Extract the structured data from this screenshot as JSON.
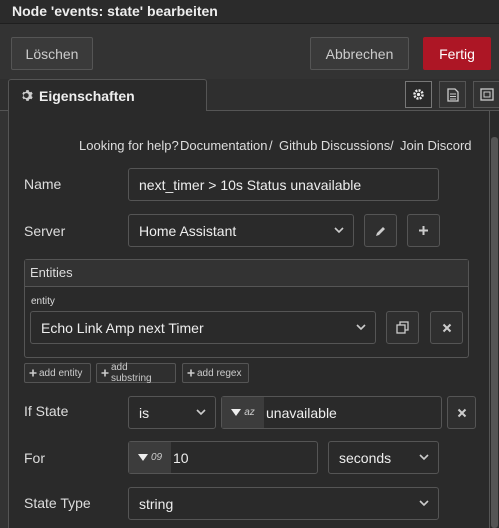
{
  "dialog": {
    "title": "Node 'events: state' bearbeiten"
  },
  "toolbar": {
    "delete_label": "Löschen",
    "cancel_label": "Abbrechen",
    "done_label": "Fertig"
  },
  "tabs": {
    "properties_label": "Eigenschaften"
  },
  "help": {
    "prefix": "Looking for help?",
    "links": [
      "Documentation",
      "Github Discussions",
      "Join Discord"
    ],
    "separator": "/"
  },
  "form": {
    "name": {
      "label": "Name",
      "value": "next_timer > 10s Status unavailable"
    },
    "server": {
      "label": "Server",
      "value": "Home Assistant"
    },
    "entities": {
      "header": "Entities",
      "sublabel": "entity",
      "value": "Echo Link Amp next Timer",
      "add_buttons": [
        "add entity",
        "add substring",
        "add regex"
      ]
    },
    "if_state": {
      "label": "If State",
      "operator": "is",
      "type_symbol": "az",
      "value": "unavailable"
    },
    "for": {
      "label": "For",
      "type_symbol": "09",
      "value": "10",
      "unit": "seconds"
    },
    "state_type": {
      "label": "State Type",
      "value": "string"
    }
  },
  "colors": {
    "primary": "#ad1625",
    "background": "#333333",
    "panel": "#2a2a2a",
    "border": "#555555",
    "text": "#cccccc"
  },
  "icons": [
    "gear-icon",
    "document-icon",
    "frame-icon",
    "pencil-icon",
    "plus-icon",
    "copy-icon",
    "close-icon",
    "chevron-down-icon",
    "caret-down-icon"
  ]
}
